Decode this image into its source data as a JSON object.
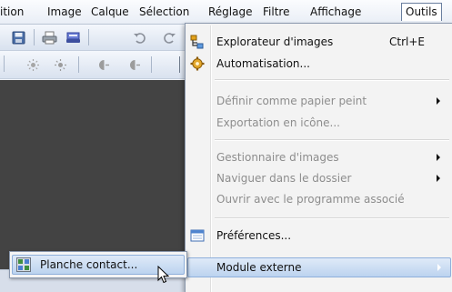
{
  "menubar": {
    "items": [
      "ition",
      "Image",
      "Calque",
      "Sélection",
      "Réglage",
      "Filtre",
      "Affichage",
      "Outils"
    ]
  },
  "tools_menu": {
    "items": {
      "explorer": {
        "label": "Explorateur d'images",
        "shortcut": "Ctrl+E",
        "icon": "explorer-icon"
      },
      "automation": {
        "label": "Automatisation...",
        "icon": "gear-icon"
      },
      "wallpaper": {
        "label": "Définir comme papier peint",
        "disabled": true,
        "has_submenu": true
      },
      "export_icon": {
        "label": "Exportation en icône...",
        "disabled": true
      },
      "image_manager": {
        "label": "Gestionnaire d'images",
        "disabled": true,
        "has_submenu": true
      },
      "browse_folder": {
        "label": "Naviguer dans le dossier",
        "disabled": true,
        "has_submenu": true
      },
      "open_with": {
        "label": "Ouvrir avec le programme associé",
        "disabled": true
      },
      "preferences": {
        "label": "Préférences...",
        "icon": "window-icon"
      },
      "external_module": {
        "label": "Module externe",
        "has_submenu": true,
        "highlighted": true
      }
    }
  },
  "submenu": {
    "item": {
      "label": "Planche contact...",
      "icon": "contact-sheet-icon",
      "highlighted": true
    }
  },
  "colors": {
    "highlight": "#bcd3ef",
    "workspace": "#434343",
    "disabled_text": "#8d8d8d"
  }
}
